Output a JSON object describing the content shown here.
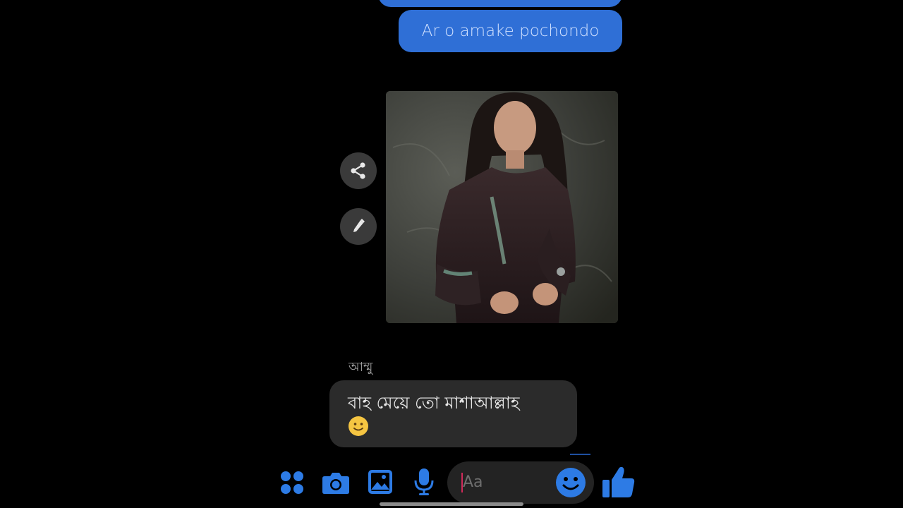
{
  "conversation": {
    "outgoing_messages": [
      {
        "text": "Ar o amake pochondo"
      }
    ],
    "shared_photo": {
      "description": "photo-attachment"
    },
    "photo_actions": {
      "share_icon": "share-icon",
      "edit_icon": "pencil-icon"
    },
    "incoming": {
      "sender": "আম্মু",
      "text": "বাহ মেয়ে তো মাশাআল্লাহ",
      "emoji": "slightly-smiling-face"
    }
  },
  "composer": {
    "placeholder": "Aa",
    "icons": [
      "grid-icon",
      "camera-icon",
      "image-icon",
      "microphone-icon",
      "emoji-icon",
      "thumbs-up-icon"
    ]
  },
  "colors": {
    "accent": "#2f6fd6",
    "icon_blue": "#2d7be5",
    "background": "#000000",
    "incoming_bubble": "#2b2b2b"
  }
}
